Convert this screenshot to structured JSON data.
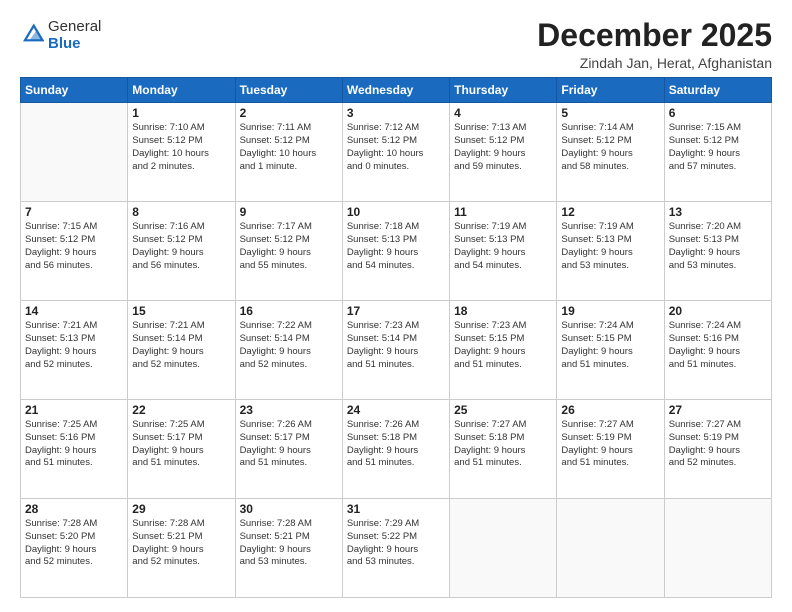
{
  "header": {
    "logo_line1": "General",
    "logo_line2": "Blue",
    "month": "December 2025",
    "location": "Zindah Jan, Herat, Afghanistan"
  },
  "days_of_week": [
    "Sunday",
    "Monday",
    "Tuesday",
    "Wednesday",
    "Thursday",
    "Friday",
    "Saturday"
  ],
  "weeks": [
    [
      {
        "day": "",
        "info": ""
      },
      {
        "day": "1",
        "info": "Sunrise: 7:10 AM\nSunset: 5:12 PM\nDaylight: 10 hours\nand 2 minutes."
      },
      {
        "day": "2",
        "info": "Sunrise: 7:11 AM\nSunset: 5:12 PM\nDaylight: 10 hours\nand 1 minute."
      },
      {
        "day": "3",
        "info": "Sunrise: 7:12 AM\nSunset: 5:12 PM\nDaylight: 10 hours\nand 0 minutes."
      },
      {
        "day": "4",
        "info": "Sunrise: 7:13 AM\nSunset: 5:12 PM\nDaylight: 9 hours\nand 59 minutes."
      },
      {
        "day": "5",
        "info": "Sunrise: 7:14 AM\nSunset: 5:12 PM\nDaylight: 9 hours\nand 58 minutes."
      },
      {
        "day": "6",
        "info": "Sunrise: 7:15 AM\nSunset: 5:12 PM\nDaylight: 9 hours\nand 57 minutes."
      }
    ],
    [
      {
        "day": "7",
        "info": "Sunrise: 7:15 AM\nSunset: 5:12 PM\nDaylight: 9 hours\nand 56 minutes."
      },
      {
        "day": "8",
        "info": "Sunrise: 7:16 AM\nSunset: 5:12 PM\nDaylight: 9 hours\nand 56 minutes."
      },
      {
        "day": "9",
        "info": "Sunrise: 7:17 AM\nSunset: 5:12 PM\nDaylight: 9 hours\nand 55 minutes."
      },
      {
        "day": "10",
        "info": "Sunrise: 7:18 AM\nSunset: 5:13 PM\nDaylight: 9 hours\nand 54 minutes."
      },
      {
        "day": "11",
        "info": "Sunrise: 7:19 AM\nSunset: 5:13 PM\nDaylight: 9 hours\nand 54 minutes."
      },
      {
        "day": "12",
        "info": "Sunrise: 7:19 AM\nSunset: 5:13 PM\nDaylight: 9 hours\nand 53 minutes."
      },
      {
        "day": "13",
        "info": "Sunrise: 7:20 AM\nSunset: 5:13 PM\nDaylight: 9 hours\nand 53 minutes."
      }
    ],
    [
      {
        "day": "14",
        "info": "Sunrise: 7:21 AM\nSunset: 5:13 PM\nDaylight: 9 hours\nand 52 minutes."
      },
      {
        "day": "15",
        "info": "Sunrise: 7:21 AM\nSunset: 5:14 PM\nDaylight: 9 hours\nand 52 minutes."
      },
      {
        "day": "16",
        "info": "Sunrise: 7:22 AM\nSunset: 5:14 PM\nDaylight: 9 hours\nand 52 minutes."
      },
      {
        "day": "17",
        "info": "Sunrise: 7:23 AM\nSunset: 5:14 PM\nDaylight: 9 hours\nand 51 minutes."
      },
      {
        "day": "18",
        "info": "Sunrise: 7:23 AM\nSunset: 5:15 PM\nDaylight: 9 hours\nand 51 minutes."
      },
      {
        "day": "19",
        "info": "Sunrise: 7:24 AM\nSunset: 5:15 PM\nDaylight: 9 hours\nand 51 minutes."
      },
      {
        "day": "20",
        "info": "Sunrise: 7:24 AM\nSunset: 5:16 PM\nDaylight: 9 hours\nand 51 minutes."
      }
    ],
    [
      {
        "day": "21",
        "info": "Sunrise: 7:25 AM\nSunset: 5:16 PM\nDaylight: 9 hours\nand 51 minutes."
      },
      {
        "day": "22",
        "info": "Sunrise: 7:25 AM\nSunset: 5:17 PM\nDaylight: 9 hours\nand 51 minutes."
      },
      {
        "day": "23",
        "info": "Sunrise: 7:26 AM\nSunset: 5:17 PM\nDaylight: 9 hours\nand 51 minutes."
      },
      {
        "day": "24",
        "info": "Sunrise: 7:26 AM\nSunset: 5:18 PM\nDaylight: 9 hours\nand 51 minutes."
      },
      {
        "day": "25",
        "info": "Sunrise: 7:27 AM\nSunset: 5:18 PM\nDaylight: 9 hours\nand 51 minutes."
      },
      {
        "day": "26",
        "info": "Sunrise: 7:27 AM\nSunset: 5:19 PM\nDaylight: 9 hours\nand 51 minutes."
      },
      {
        "day": "27",
        "info": "Sunrise: 7:27 AM\nSunset: 5:19 PM\nDaylight: 9 hours\nand 52 minutes."
      }
    ],
    [
      {
        "day": "28",
        "info": "Sunrise: 7:28 AM\nSunset: 5:20 PM\nDaylight: 9 hours\nand 52 minutes."
      },
      {
        "day": "29",
        "info": "Sunrise: 7:28 AM\nSunset: 5:21 PM\nDaylight: 9 hours\nand 52 minutes."
      },
      {
        "day": "30",
        "info": "Sunrise: 7:28 AM\nSunset: 5:21 PM\nDaylight: 9 hours\nand 53 minutes."
      },
      {
        "day": "31",
        "info": "Sunrise: 7:29 AM\nSunset: 5:22 PM\nDaylight: 9 hours\nand 53 minutes."
      },
      {
        "day": "",
        "info": ""
      },
      {
        "day": "",
        "info": ""
      },
      {
        "day": "",
        "info": ""
      }
    ]
  ]
}
